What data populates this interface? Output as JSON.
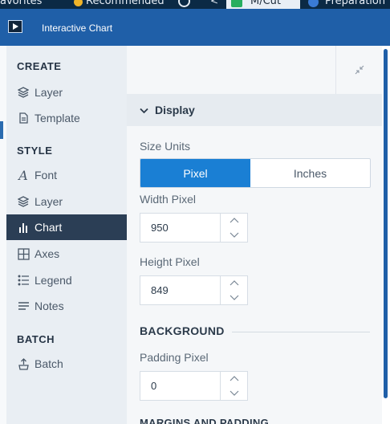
{
  "taskbar": {
    "item1": "avorites",
    "item2": "Recommended",
    "tab_active": "M/Cut",
    "item4": "Preparation"
  },
  "window": {
    "title": "Interactive Chart"
  },
  "sidebar": {
    "create_header": "CREATE",
    "create_items": [
      {
        "label": "Layer",
        "icon": "layers-icon"
      },
      {
        "label": "Template",
        "icon": "document-icon"
      }
    ],
    "style_header": "STYLE",
    "style_items": [
      {
        "label": "Font",
        "icon": "font-icon"
      },
      {
        "label": "Layer",
        "icon": "layers-icon"
      },
      {
        "label": "Chart",
        "icon": "bar-chart-icon",
        "active": true
      },
      {
        "label": "Axes",
        "icon": "grid-icon"
      },
      {
        "label": "Legend",
        "icon": "legend-list-icon"
      },
      {
        "label": "Notes",
        "icon": "notes-icon"
      }
    ],
    "batch_header": "BATCH",
    "batch_items": [
      {
        "label": "Batch",
        "icon": "batch-icon"
      }
    ]
  },
  "panel": {
    "section_title": "Display",
    "size_units_label": "Size Units",
    "size_units_options": [
      "Pixel",
      "Inches"
    ],
    "size_units_selected": "Pixel",
    "width_label": "Width Pixel",
    "width_value": "950",
    "height_label": "Height Pixel",
    "height_value": "849",
    "background_header": "BACKGROUND",
    "padding_label": "Padding Pixel",
    "padding_value": "0",
    "next_header": "MARGINS AND PADDING"
  },
  "colors": {
    "titlebar": "#1f5fa8",
    "accent": "#1a7fd4",
    "sidebar_active": "#2b3e55",
    "sidebar_bg": "#e9eef3"
  }
}
